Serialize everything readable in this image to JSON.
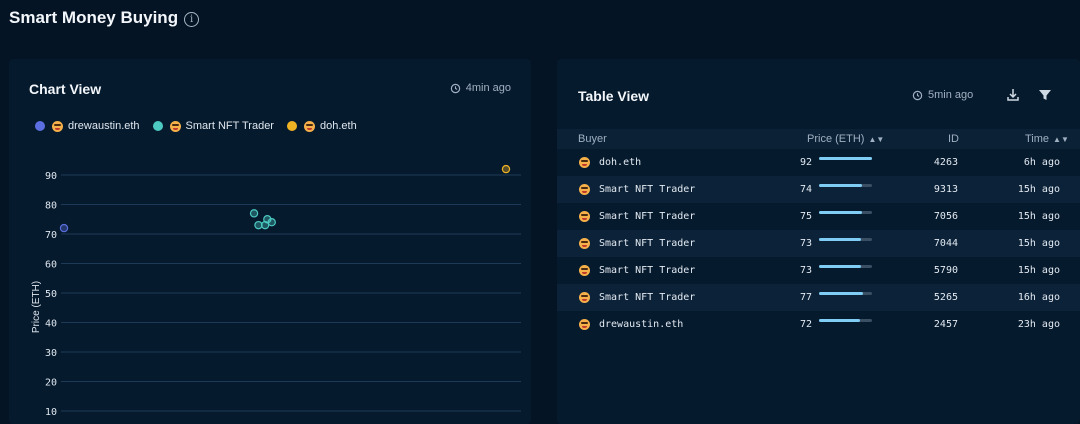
{
  "header": {
    "title": "Smart Money Buying",
    "info_icon": "info-icon"
  },
  "chart_card": {
    "title": "Chart View",
    "updated": "4min ago",
    "legend": [
      {
        "label": "drewaustin.eth",
        "color": "#5b6fe0"
      },
      {
        "label": "Smart NFT Trader",
        "color": "#4cc9c0"
      },
      {
        "label": "doh.eth",
        "color": "#f0b323"
      }
    ]
  },
  "chart_data": {
    "type": "scatter",
    "ylabel": "Price (ETH)",
    "xlabel": "",
    "ylim": [
      10,
      95
    ],
    "y_ticks": [
      "90",
      "80",
      "70",
      "60",
      "50",
      "40",
      "30",
      "20",
      "10"
    ],
    "grid": true,
    "legend_position": "top-left",
    "series": [
      {
        "name": "drewaustin.eth",
        "color": "#5b6fe0",
        "points": [
          {
            "x": 0.0,
            "y": 72
          }
        ]
      },
      {
        "name": "Smart NFT Trader",
        "color": "#4cc9c0",
        "points": [
          {
            "x": 0.43,
            "y": 77
          },
          {
            "x": 0.44,
            "y": 73
          },
          {
            "x": 0.455,
            "y": 73
          },
          {
            "x": 0.46,
            "y": 75
          },
          {
            "x": 0.47,
            "y": 74
          }
        ]
      },
      {
        "name": "doh.eth",
        "color": "#f0b323",
        "points": [
          {
            "x": 1.0,
            "y": 92
          }
        ]
      }
    ]
  },
  "table_card": {
    "title": "Table View",
    "updated": "5min ago",
    "columns": {
      "buyer": "Buyer",
      "price": "Price (ETH)",
      "id": "ID",
      "time": "Time"
    },
    "rows": [
      {
        "buyer": "doh.eth",
        "price": "92",
        "price_value": 92,
        "id": "4263",
        "time": "6h ago"
      },
      {
        "buyer": "Smart NFT Trader",
        "price": "74",
        "price_value": 74,
        "id": "9313",
        "time": "15h ago"
      },
      {
        "buyer": "Smart NFT Trader",
        "price": "75",
        "price_value": 75,
        "id": "7056",
        "time": "15h ago"
      },
      {
        "buyer": "Smart NFT Trader",
        "price": "73",
        "price_value": 73,
        "id": "7044",
        "time": "15h ago"
      },
      {
        "buyer": "Smart NFT Trader",
        "price": "73",
        "price_value": 73,
        "id": "5790",
        "time": "15h ago"
      },
      {
        "buyer": "Smart NFT Trader",
        "price": "77",
        "price_value": 77,
        "id": "5265",
        "time": "16h ago"
      },
      {
        "buyer": "drewaustin.eth",
        "price": "72",
        "price_value": 72,
        "id": "2457",
        "time": "23h ago"
      }
    ],
    "price_max": 92
  }
}
